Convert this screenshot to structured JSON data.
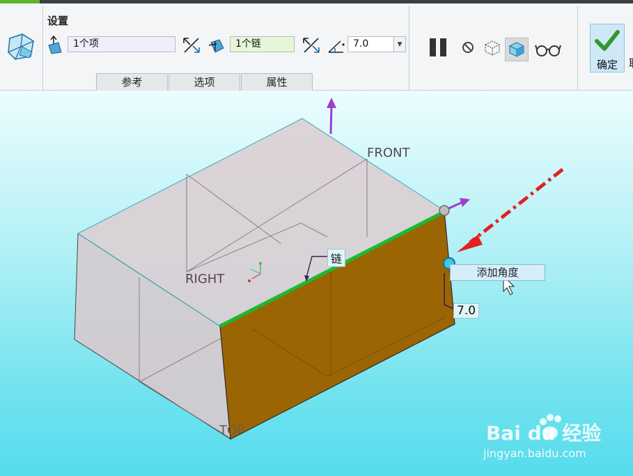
{
  "toolbar": {
    "group_title": "设置",
    "reference_value": "1个项",
    "chain_value": "1个链",
    "angle_value": "7.0",
    "tabs": [
      {
        "label": "参考"
      },
      {
        "label": "选项"
      },
      {
        "label": "属性"
      }
    ],
    "ok_label": "确定",
    "cut_label": "取"
  },
  "viewport": {
    "datum_labels": {
      "front": "FRONT",
      "right": "RIGHT",
      "top": "TOP"
    },
    "chain_tag": "链",
    "dimension_value": "7.0",
    "tooltip": "添加角度"
  },
  "watermark": {
    "brand": "Bai du 经验",
    "url": "jingyan.baidu.com"
  },
  "colors": {
    "accent_green": "#5fb22b",
    "draft_face": "#9b6503",
    "chain_edge": "#1db831",
    "arrow_red": "#e32020"
  }
}
